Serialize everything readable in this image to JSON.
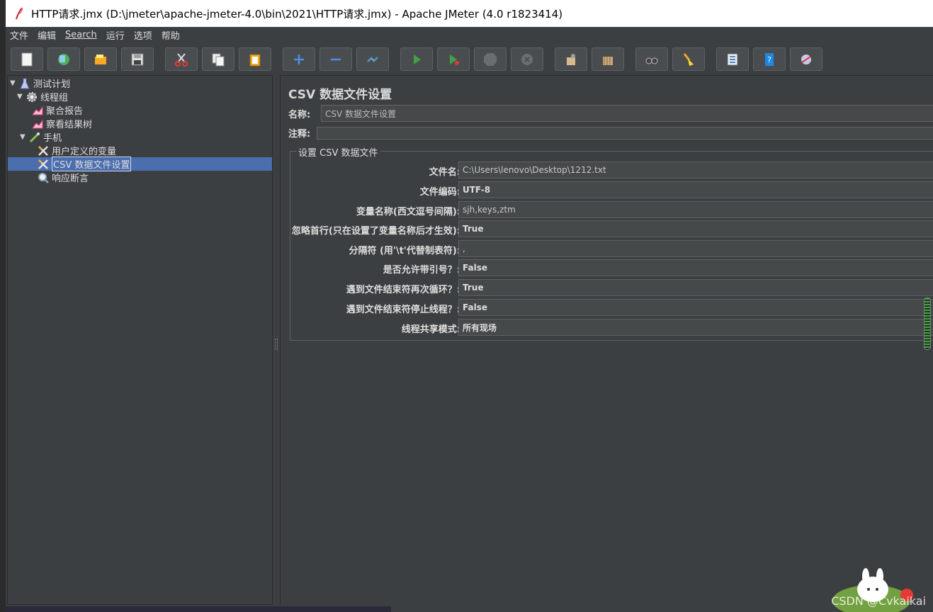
{
  "window": {
    "title": "HTTP请求.jmx (D:\\jmeter\\apache-jmeter-4.0\\bin\\2021\\HTTP请求.jmx) - Apache JMeter (4.0 r1823414)"
  },
  "menu": [
    "文件",
    "编辑",
    "Search",
    "运行",
    "选项",
    "帮助"
  ],
  "toolbar": {
    "icons": [
      "new-icon",
      "templates-icon",
      "open-icon",
      "save-icon",
      "cut-icon",
      "copy-icon",
      "paste-icon",
      "expand-icon",
      "collapse-icon",
      "toggle-icon",
      "start-icon",
      "start-no-pause-icon",
      "stop-icon",
      "shutdown-icon",
      "clear-icon",
      "clear-all-icon",
      "search-icon",
      "reset-search-icon",
      "function-helper-icon",
      "help-icon",
      "remote-icon"
    ]
  },
  "tree": [
    {
      "label": "测试计划",
      "icon": "test-plan-icon",
      "expanded": true
    },
    {
      "label": "线程组",
      "icon": "thread-group-icon",
      "expanded": true
    },
    {
      "label": "聚合报告",
      "icon": "listener-icon"
    },
    {
      "label": "察看结果树",
      "icon": "listener-icon"
    },
    {
      "label": "手机",
      "icon": "sampler-icon",
      "expanded": true
    },
    {
      "label": "用户定义的变量",
      "icon": "config-icon"
    },
    {
      "label": "CSV 数据文件设置",
      "icon": "config-icon",
      "selected": true
    },
    {
      "label": "响应断言",
      "icon": "assertion-icon"
    }
  ],
  "panel": {
    "title": "CSV 数据文件设置",
    "name_label": "名称:",
    "name_value": "CSV 数据文件设置",
    "comment_label": "注释:",
    "comment_value": "",
    "group_title": "设置 CSV 数据文件",
    "properties": [
      {
        "label": "文件名:",
        "value": "C:\\Users\\lenovo\\Desktop\\1212.txt",
        "kind": "text"
      },
      {
        "label": "文件编码:",
        "value": "UTF-8",
        "kind": "combo"
      },
      {
        "label": "变量名称(西文逗号间隔):",
        "value": "sjh,keys,ztm",
        "kind": "text"
      },
      {
        "label": "忽略首行(只在设置了变量名称后才生效):",
        "value": "True",
        "kind": "combo"
      },
      {
        "label": "分隔符 (用'\\t'代替制表符):",
        "value": ",",
        "kind": "text"
      },
      {
        "label": "是否允许带引号？:",
        "value": "False",
        "kind": "combo"
      },
      {
        "label": "遇到文件结束符再次循环？:",
        "value": "True",
        "kind": "combo"
      },
      {
        "label": "遇到文件结束符停止线程？:",
        "value": "False",
        "kind": "combo"
      },
      {
        "label": "线程共享模式:",
        "value": "所有现场",
        "kind": "combo"
      }
    ]
  },
  "watermark": "CSDN @Cvkaikai"
}
